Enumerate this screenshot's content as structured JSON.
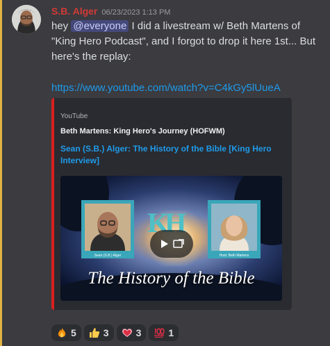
{
  "author": {
    "name": "S.B. Alger",
    "color": "#d33a36"
  },
  "timestamp": "06/23/2023 1:13 PM",
  "message": {
    "pre_mention": "hey ",
    "mention": "@everyone",
    "post_mention": "  I did a livestream w/ Beth Martens of \"King Hero Podcast\", and I forgot to drop it here 1st... But here's the replay:"
  },
  "link": "https://www.youtube.com/watch?v=C4kGy5lUueA",
  "embed": {
    "provider": "YouTube",
    "author": "Beth Martens: King Hero's Journey (HOFWM)",
    "title": "Sean (S.B.) Alger: The History of the Bible [King Hero Interview]",
    "accent_color": "#d8201f",
    "thumbnail": {
      "logo": "KH",
      "title": "The History of the Bible",
      "guest_caption": "Sean (S.B.) Alger",
      "host_caption": "Host: Beth Martens"
    }
  },
  "reactions": [
    {
      "icon": "fire-icon",
      "count": "5"
    },
    {
      "icon": "thumbs-up-icon",
      "count": "3"
    },
    {
      "icon": "heart-icon",
      "count": "3"
    },
    {
      "icon": "hundred-points-icon",
      "count": "1"
    }
  ],
  "colors": {
    "mention_bar": "#e3b341",
    "link": "#1f9bea",
    "background": "#3b3b40"
  }
}
